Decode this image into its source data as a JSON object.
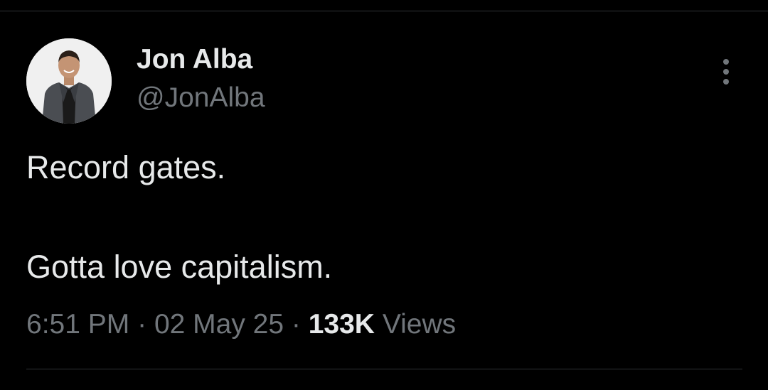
{
  "tweet": {
    "author": {
      "display_name": "Jon Alba",
      "handle": "@JonAlba",
      "avatar_icon": "profile-photo"
    },
    "more_icon": "more-vertical-icon",
    "text_lines": [
      "Record gates.",
      "Gotta love capitalism."
    ],
    "meta": {
      "time": "6:51 PM",
      "separator": "·",
      "date": "02 May 25",
      "views_count": "133K",
      "views_label": "Views"
    }
  },
  "colors": {
    "background": "#000000",
    "primary_text": "#e7e9ea",
    "secondary_text": "#71767b",
    "divider": "#2f3336"
  }
}
